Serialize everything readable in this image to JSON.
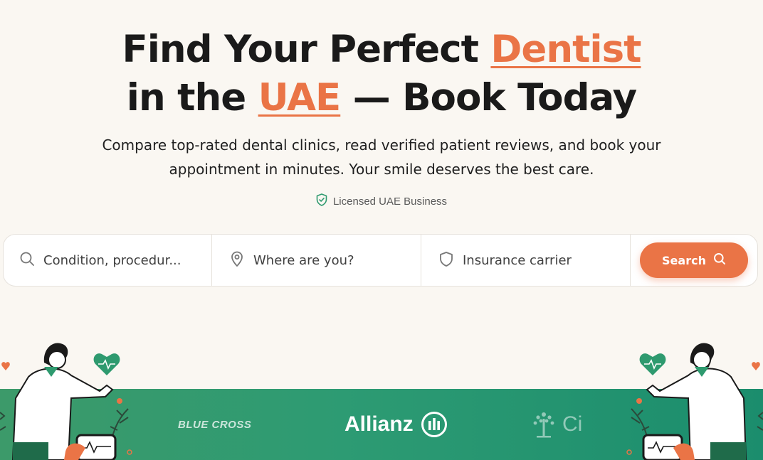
{
  "hero": {
    "title_part1": "Find Your Perfect ",
    "title_accent1": "Dentist",
    "title_part2": "in the ",
    "title_accent2": "UAE",
    "title_part3": " — Book Today",
    "subtitle": "Compare top-rated dental clinics, read verified patient reviews, and book your appointment in minutes. Your smile deserves the best care.",
    "badge": "Licensed UAE Business"
  },
  "search": {
    "condition_placeholder": "Condition, procedur...",
    "location_placeholder": "Where are you?",
    "insurance_placeholder": "Insurance carrier",
    "button_label": "Search"
  },
  "insurers": {
    "logo1": "BLUE CROSS",
    "logo2": "Allianz",
    "logo3": "Ci"
  },
  "colors": {
    "accent": "#ea7446",
    "background": "#faf7f2",
    "band": "#2d9b73",
    "icon_green": "#2e9a6f"
  },
  "icons": [
    "shield-check-icon",
    "search-icon",
    "map-pin-icon",
    "shield-icon"
  ]
}
